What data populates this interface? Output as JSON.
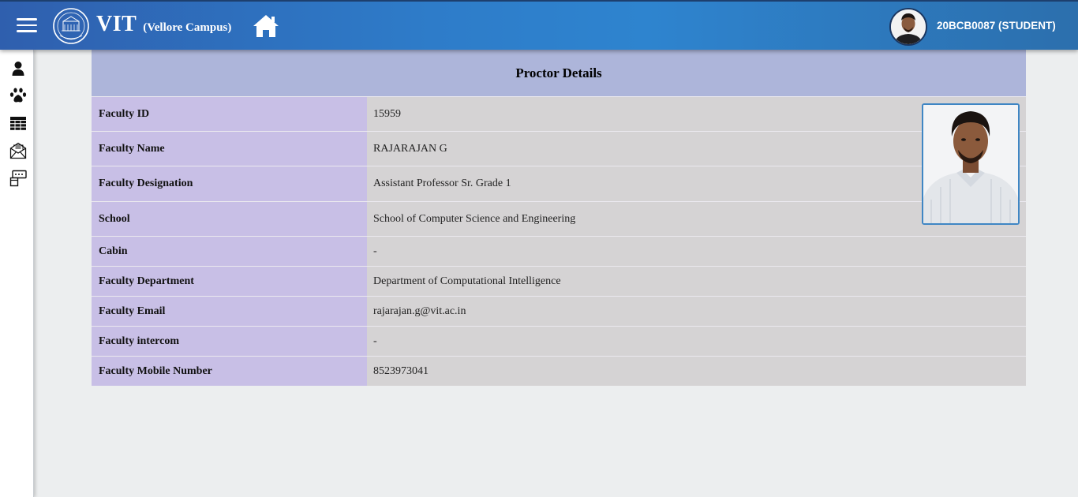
{
  "header": {
    "brand": "VIT",
    "campus": "(Vellore Campus)",
    "user_label": "20BCB0087 (STUDENT)"
  },
  "icons": {
    "menu": "hamburger-menu-icon",
    "logo": "vit-logo",
    "home": "home-icon",
    "sidebar": [
      "user-icon",
      "paw-icon",
      "table-grid-icon",
      "mail-icon",
      "card-icon"
    ]
  },
  "colors": {
    "header_gradient_start": "#2f5fae",
    "header_gradient_end": "#2c6fad",
    "panel_header": "#adb5da",
    "label_cell": "#c8bfe6",
    "value_cell": "#d5d3d4",
    "photo_border": "#3f86c4"
  },
  "proctor": {
    "title": "Proctor Details",
    "rows": [
      {
        "label": "Faculty ID",
        "value": "15959"
      },
      {
        "label": "Faculty Name",
        "value": "RAJARAJAN G"
      },
      {
        "label": "Faculty Designation",
        "value": "Assistant Professor Sr. Grade 1"
      },
      {
        "label": "School",
        "value": "School of Computer Science and Engineering"
      },
      {
        "label": "Cabin",
        "value": "-"
      },
      {
        "label": "Faculty Department",
        "value": "Department of Computational Intelligence"
      },
      {
        "label": "Faculty Email",
        "value": "rajarajan.g@vit.ac.in"
      },
      {
        "label": "Faculty intercom",
        "value": "-"
      },
      {
        "label": "Faculty Mobile Number",
        "value": "8523973041"
      }
    ]
  }
}
